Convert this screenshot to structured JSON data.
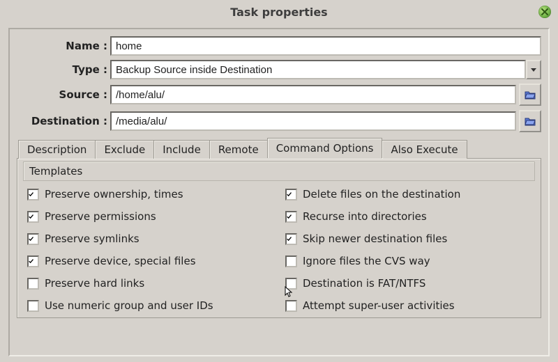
{
  "title": "Task properties",
  "fields": {
    "nameLabel": "Name :",
    "nameValue": "home",
    "typeLabel": "Type :",
    "typeValue": "Backup Source inside Destination",
    "sourceLabel": "Source :",
    "sourceValue": "/home/alu/",
    "destLabel": "Destination :",
    "destValue": "/media/alu/"
  },
  "tabs": {
    "description": "Description",
    "exclude": "Exclude",
    "include": "Include",
    "remote": "Remote",
    "commandOptions": "Command Options",
    "alsoExecute": "Also Execute"
  },
  "panel": {
    "templatesHeader": "Templates",
    "left": [
      {
        "key": "preserve-ownership",
        "label": "Preserve ownership, times",
        "checked": true
      },
      {
        "key": "preserve-permissions",
        "label": "Preserve permissions",
        "checked": true
      },
      {
        "key": "preserve-symlinks",
        "label": "Preserve symlinks",
        "checked": true
      },
      {
        "key": "preserve-device",
        "label": "Preserve device, special files",
        "checked": true
      },
      {
        "key": "preserve-hardlinks",
        "label": "Preserve hard links",
        "checked": false
      },
      {
        "key": "numeric-ids",
        "label": "Use numeric group and user IDs",
        "checked": false
      }
    ],
    "right": [
      {
        "key": "delete-dest",
        "label": "Delete files on the destination",
        "checked": true
      },
      {
        "key": "recurse",
        "label": "Recurse into directories",
        "checked": true
      },
      {
        "key": "skip-newer",
        "label": "Skip newer destination files",
        "checked": true
      },
      {
        "key": "ignore-cvs",
        "label": "Ignore files the CVS way",
        "checked": false
      },
      {
        "key": "fat-ntfs",
        "label": "Destination is FAT/NTFS",
        "checked": false
      },
      {
        "key": "super-user",
        "label": "Attempt super-user activities",
        "checked": false
      }
    ]
  }
}
